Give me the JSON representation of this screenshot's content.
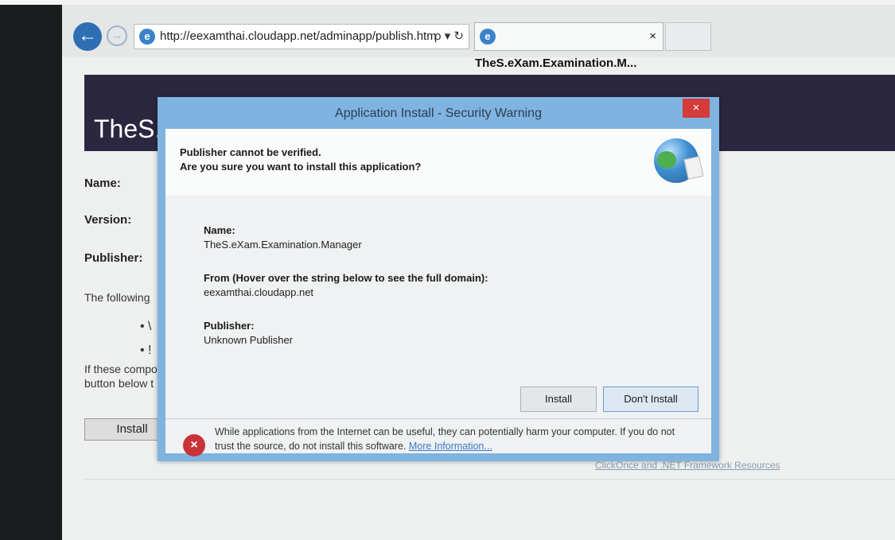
{
  "browser": {
    "url": "http://eexamthai.cloudapp.net/adminapp/publish.htm",
    "address_tools": "ρ ▾ ↻",
    "tab_title": "TheS.eXam.Examination.M...",
    "tab_close": "×"
  },
  "page": {
    "title": "TheS.e",
    "labels": {
      "name": "Name:",
      "version": "Version:",
      "publisher": "Publisher:"
    },
    "following": "The following",
    "bullets": [
      "• \\",
      "• !"
    ],
    "if_these_line1": "If these compo",
    "if_these_line2": "button below t",
    "install_button": "Install",
    "resources_link": "ClickOnce and .NET Framework Resources"
  },
  "dialog": {
    "title": "Application Install - Security Warning",
    "close": "×",
    "heading1": "Publisher cannot be verified.",
    "heading2": "Are you sure you want to install this application?",
    "name_label": "Name:",
    "name_value": "TheS.eXam.Examination.Manager",
    "from_label": "From (Hover over the string below to see the full domain):",
    "from_value": "eexamthai.cloudapp.net",
    "publisher_label": "Publisher:",
    "publisher_value": "Unknown Publisher",
    "install_button": "Install",
    "dont_install_button": "Don't Install",
    "warning_text": "While applications from the Internet can be useful, they can potentially harm your computer. If you do not trust the source, do not install this software.",
    "more_info": "More Information..."
  }
}
